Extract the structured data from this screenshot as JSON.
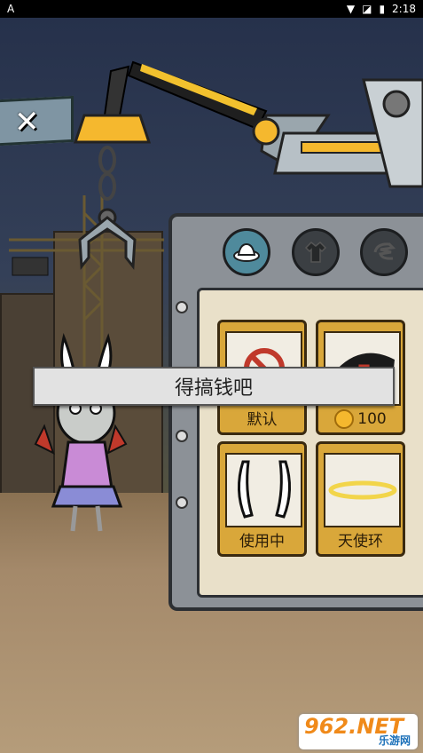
{
  "status_bar": {
    "time": "2:18",
    "app_badge": "A"
  },
  "close_button": {
    "glyph": "✕"
  },
  "tabs": [
    {
      "id": "hat",
      "icon": "hat-icon",
      "active": true
    },
    {
      "id": "clothes",
      "icon": "shirt-icon",
      "active": false
    },
    {
      "id": "extra",
      "icon": "swirl-icon",
      "active": false
    }
  ],
  "items": [
    {
      "label": "默认",
      "icon": "prohibited-icon"
    },
    {
      "label": "100",
      "icon": "coin-icon",
      "price": 100
    },
    {
      "label": "使用中",
      "icon": "bunny-ears-icon"
    },
    {
      "label": "天使环",
      "icon": "halo-icon"
    }
  ],
  "toast": {
    "message": "得搞钱吧"
  },
  "watermark": {
    "brand": "962.NET",
    "subtitle": "乐游网"
  },
  "colors": {
    "panel": "#8c9197",
    "card": "#d9a73a",
    "accent": "#f5b82e",
    "tab_active": "#4f8a9c"
  }
}
